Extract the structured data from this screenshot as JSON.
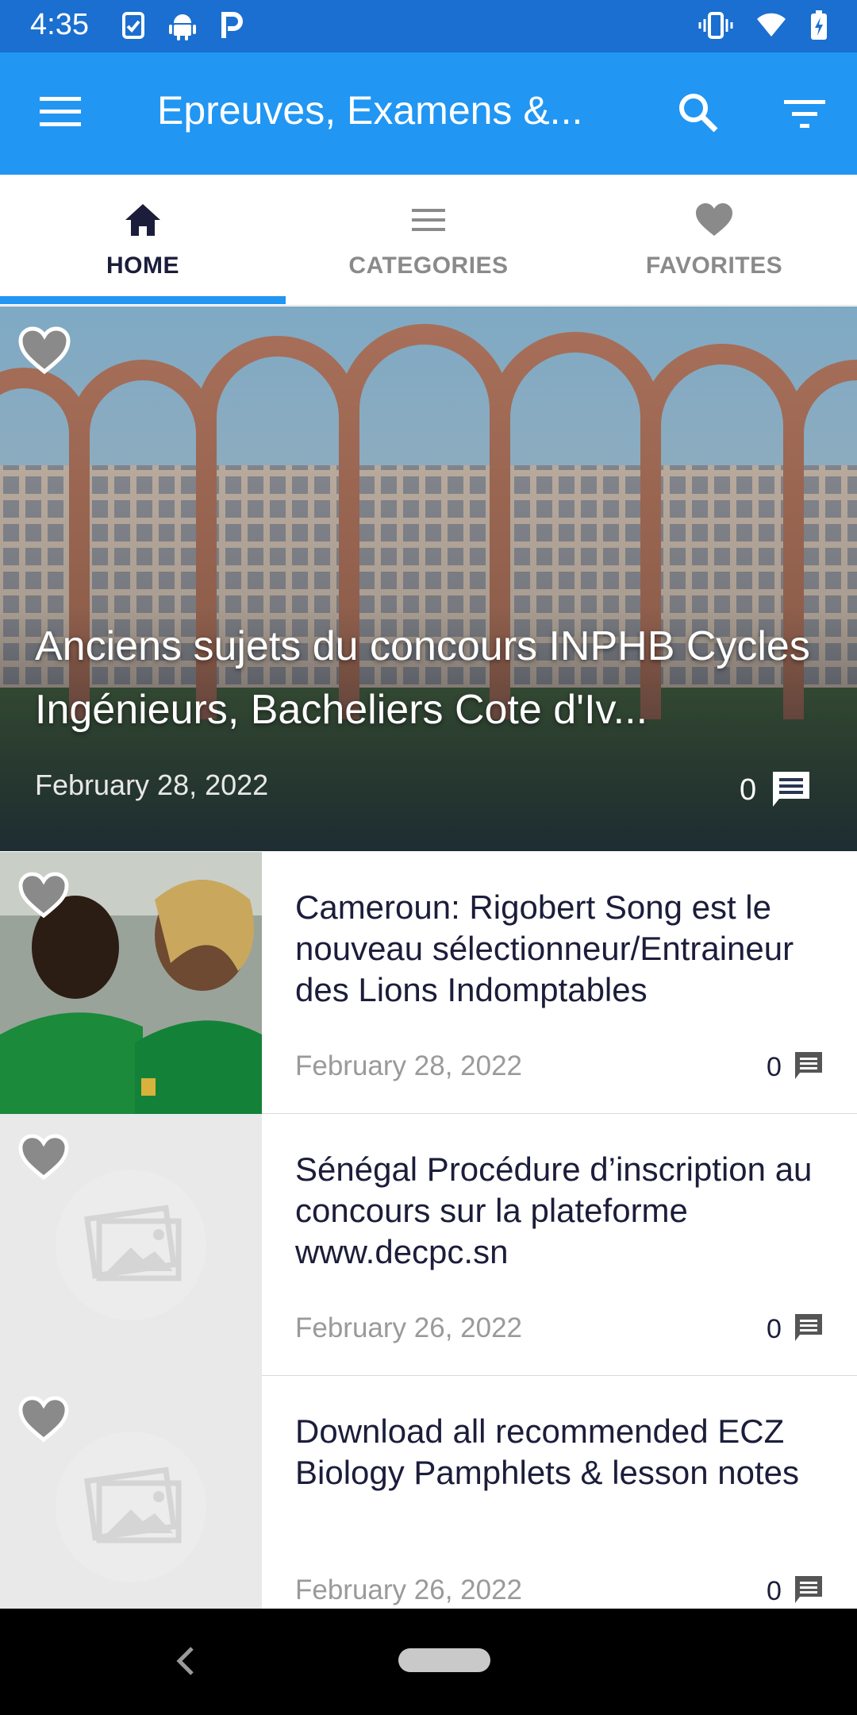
{
  "status_bar": {
    "time": "4:35",
    "left_icons": [
      "clipboard-check-icon",
      "android-icon",
      "parking-p-icon"
    ],
    "right_icons": [
      "vibrate-icon",
      "wifi-icon",
      "battery-charging-icon"
    ]
  },
  "app_bar": {
    "title": "Epreuves, Examens &...",
    "menu_icon": "hamburger-menu-icon",
    "search_icon": "search-icon",
    "filter_icon": "filter-icon",
    "color": "#2196f3"
  },
  "tabs": [
    {
      "label": "HOME",
      "icon": "home-icon",
      "active": true
    },
    {
      "label": "CATEGORIES",
      "icon": "list-icon",
      "active": false
    },
    {
      "label": "FAVORITES",
      "icon": "heart-icon",
      "active": false
    }
  ],
  "featured": {
    "title": "Anciens sujets du concours INPHB Cycles Ingénieurs, Bacheliers Cote d'Iv...",
    "date": "February 28, 2022",
    "comments": "0"
  },
  "posts": [
    {
      "title": "Cameroun: Rigobert Song est le nouveau sélectionneur/Entraineur des Lions Indomptables",
      "date": "February 28, 2022",
      "comments": "0",
      "thumbnail": "photo"
    },
    {
      "title": "Sénégal Procédure d’inscription au concours sur la plateforme www.decpc.sn",
      "date": "February 26, 2022",
      "comments": "0",
      "thumbnail": "placeholder-image-icon"
    },
    {
      "title": "Download all recommended ECZ Biology Pamphlets & lesson notes",
      "date": "February 26, 2022",
      "comments": "0",
      "thumbnail": "placeholder-image-icon"
    }
  ],
  "nav_bar": {
    "back_icon": "back-chevron-icon",
    "home_icon": "home-pill-icon"
  }
}
